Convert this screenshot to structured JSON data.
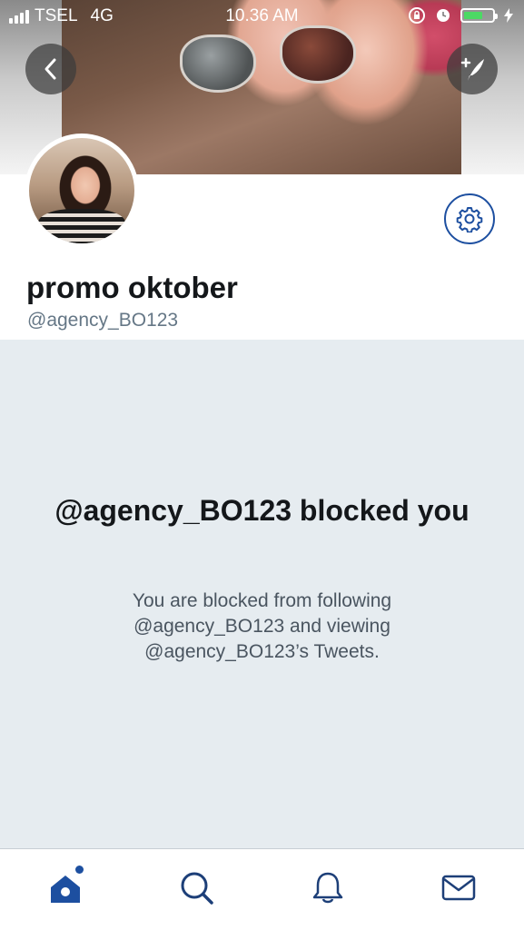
{
  "status_bar": {
    "carrier": "TSEL",
    "network": "4G",
    "time": "10.36 AM",
    "battery_color": "#4cd964"
  },
  "header": {
    "back_icon": "chevron-left-icon",
    "compose_icon": "compose-tweet-icon"
  },
  "profile": {
    "display_name": "promo oktober",
    "handle": "@agency_BO123",
    "settings_icon": "gear-icon"
  },
  "blocked": {
    "title": "@agency_BO123 blocked you",
    "description": "You are blocked from following @agency_BO123 and viewing @agency_BO123’s Tweets."
  },
  "tabs": [
    {
      "name": "home",
      "icon": "home-icon",
      "active": true
    },
    {
      "name": "search",
      "icon": "search-icon",
      "active": false
    },
    {
      "name": "notifications",
      "icon": "bell-icon",
      "active": false
    },
    {
      "name": "messages",
      "icon": "envelope-icon",
      "active": false
    }
  ],
  "colors": {
    "accent": "#1d4fa0",
    "panel_bg": "#e6ecf0",
    "text_primary": "#14171a",
    "text_secondary": "#657786"
  }
}
